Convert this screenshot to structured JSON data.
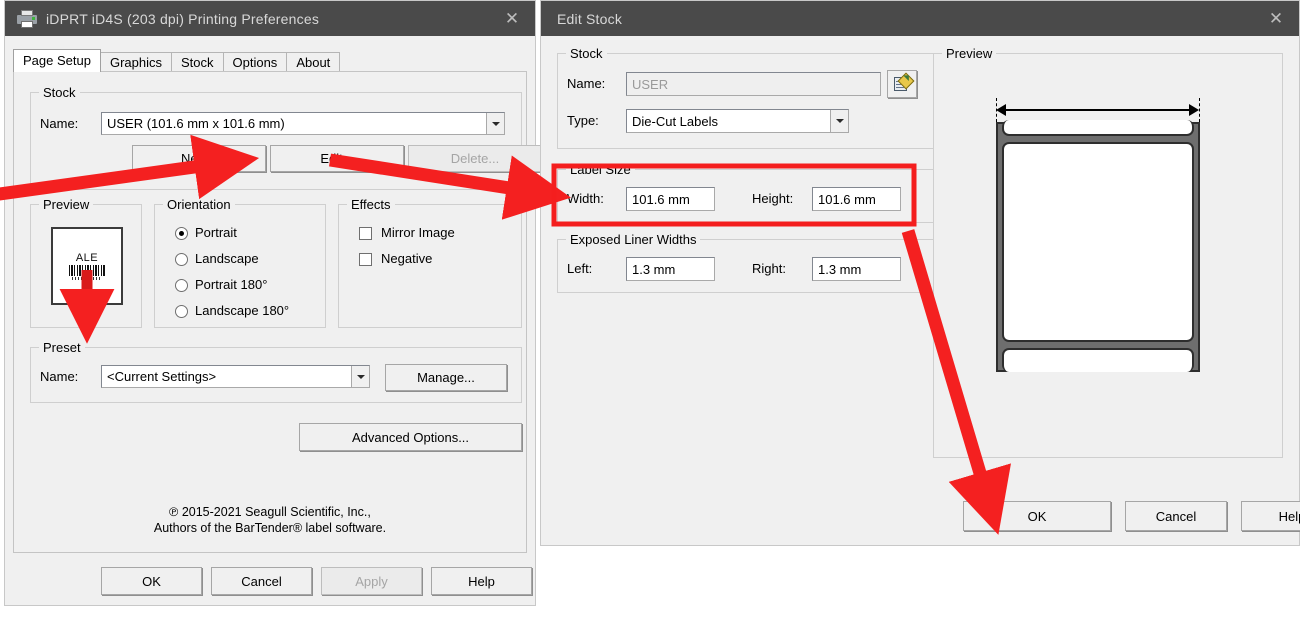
{
  "printing_preferences": {
    "title": "iDPRT iD4S (203 dpi) Printing Preferences",
    "close_label": "✕",
    "tabs": [
      {
        "label": "Page Setup",
        "active": true
      },
      {
        "label": "Graphics",
        "active": false
      },
      {
        "label": "Stock",
        "active": false
      },
      {
        "label": "Options",
        "active": false
      },
      {
        "label": "About",
        "active": false
      }
    ],
    "stock_group": {
      "legend": "Stock",
      "name_label": "Name:",
      "name_value": "USER (101.6 mm x 101.6 mm)",
      "buttons": {
        "new": "New...",
        "edit": "Edit...",
        "delete": "Delete..."
      }
    },
    "preview_group": {
      "legend": "Preview",
      "label_text": "ALE"
    },
    "orientation_group": {
      "legend": "Orientation",
      "options": [
        {
          "label": "Portrait",
          "selected": true
        },
        {
          "label": "Landscape",
          "selected": false
        },
        {
          "label": "Portrait 180°",
          "selected": false
        },
        {
          "label": "Landscape 180°",
          "selected": false
        }
      ]
    },
    "effects_group": {
      "legend": "Effects",
      "options": [
        {
          "label": "Mirror Image",
          "checked": false
        },
        {
          "label": "Negative",
          "checked": false
        }
      ]
    },
    "preset_group": {
      "legend": "Preset",
      "name_label": "Name:",
      "name_value": "<Current Settings>",
      "manage_button": "Manage..."
    },
    "advanced_button": "Advanced Options...",
    "copyright": "℗ 2015-2021 Seagull Scientific, Inc.,\nAuthors of the BarTender® label software.",
    "footer_buttons": {
      "ok": "OK",
      "cancel": "Cancel",
      "apply": "Apply",
      "help": "Help"
    }
  },
  "edit_stock": {
    "title": "Edit Stock",
    "close_label": "✕",
    "stock_group": {
      "legend": "Stock",
      "name_label": "Name:",
      "name_value": "USER",
      "type_label": "Type:",
      "type_value": "Die-Cut Labels"
    },
    "label_size_group": {
      "legend": "Label Size",
      "width_label": "Width:",
      "width_value": "101.6 mm",
      "height_label": "Height:",
      "height_value": "101.6 mm"
    },
    "liner_group": {
      "legend": "Exposed Liner Widths",
      "left_label": "Left:",
      "left_value": "1.3 mm",
      "right_label": "Right:",
      "right_value": "1.3 mm"
    },
    "preview_group": {
      "legend": "Preview"
    },
    "footer_buttons": {
      "ok": "OK",
      "cancel": "Cancel",
      "help": "Help"
    }
  },
  "annotations": {
    "highlight_color": "#f41e1e",
    "arrow_color": "#f42020"
  }
}
